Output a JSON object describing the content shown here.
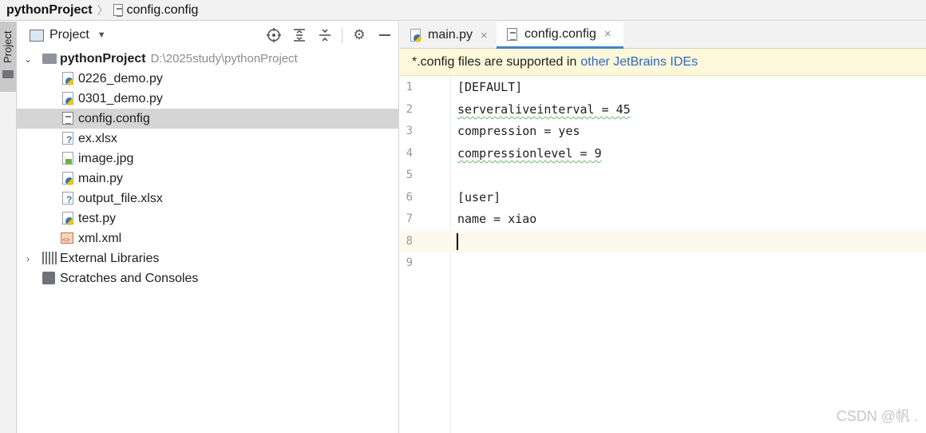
{
  "breadcrumb": {
    "project": "pythonProject",
    "separator": "〉",
    "file": "config.config",
    "file_icon": "text-file-icon"
  },
  "side_strip": {
    "tab_label": "Project"
  },
  "project_panel": {
    "title": "Project",
    "tools": [
      "locate-icon",
      "expand-all-icon",
      "collapse-all-icon",
      "gear-icon",
      "minimize-icon"
    ],
    "tree": {
      "root": {
        "name": "pythonProject",
        "path": "D:\\2025study\\pythonProject",
        "expanded": true
      },
      "files": [
        {
          "name": "0226_demo.py",
          "icon": "python-file-icon"
        },
        {
          "name": "0301_demo.py",
          "icon": "python-file-icon"
        },
        {
          "name": "config.config",
          "icon": "text-file-icon",
          "selected": true
        },
        {
          "name": "ex.xlsx",
          "icon": "unknown-file-icon"
        },
        {
          "name": "image.jpg",
          "icon": "image-file-icon"
        },
        {
          "name": "main.py",
          "icon": "python-file-icon"
        },
        {
          "name": "output_file.xlsx",
          "icon": "unknown-file-icon"
        },
        {
          "name": "test.py",
          "icon": "python-file-icon"
        },
        {
          "name": "xml.xml",
          "icon": "xml-file-icon"
        }
      ],
      "external_libraries": "External Libraries",
      "scratches": "Scratches and Consoles"
    }
  },
  "editor": {
    "tabs": [
      {
        "label": "main.py",
        "close": "×",
        "active": false
      },
      {
        "label": "config.config",
        "close": "×",
        "active": true
      }
    ],
    "banner": {
      "text": "*.config files are supported in",
      "link": "other JetBrains IDEs"
    },
    "line_numbers": [
      "1",
      "2",
      "3",
      "4",
      "5",
      "6",
      "7",
      "8",
      "9"
    ],
    "lines": [
      "[DEFAULT]",
      "serveraliveinterval = 45",
      "compression = yes",
      "compressionlevel = 9",
      "",
      "[user]",
      "name = xiao",
      "",
      ""
    ],
    "caret_line": 8
  },
  "watermark": "CSDN @帆 .",
  "colors": {
    "accent": "#4083c9",
    "selection": "#d5d5d5",
    "banner_bg": "#fcf8d9",
    "link": "#2f65ca"
  }
}
